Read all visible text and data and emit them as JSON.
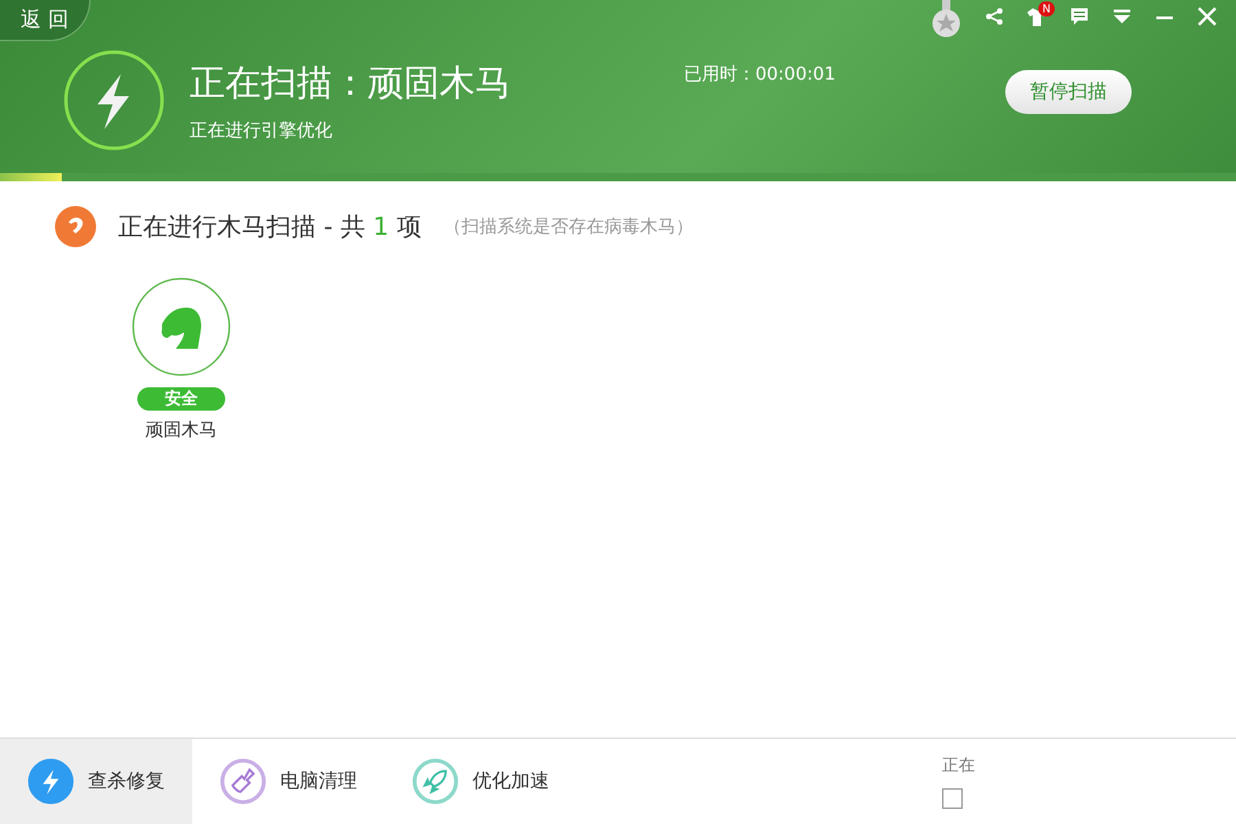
{
  "back": {
    "label": "返 回"
  },
  "header": {
    "title": "正在扫描：顽固木马",
    "subtitle": "正在进行引擎优化",
    "elapsed": "已用时：00:00:01",
    "pause_button": "暂停扫描",
    "badge": "N"
  },
  "progress": {
    "level": 0.05
  },
  "section": {
    "title": "正在进行木马扫描 - 共 **1** 项",
    "hint": "（扫描系统是否存在病毒木马）"
  },
  "items": [
    {
      "name": "顽固木马",
      "status": "安全"
    }
  ],
  "nav": [
    {
      "label": "查杀修复",
      "kind": "scan",
      "selected": true
    },
    {
      "label": "电脑清理",
      "kind": "clean",
      "selected": false
    },
    {
      "label": "优化加速",
      "kind": "speed",
      "selected": false
    }
  ],
  "engine": {
    "label": "正在",
    "checked": false
  }
}
